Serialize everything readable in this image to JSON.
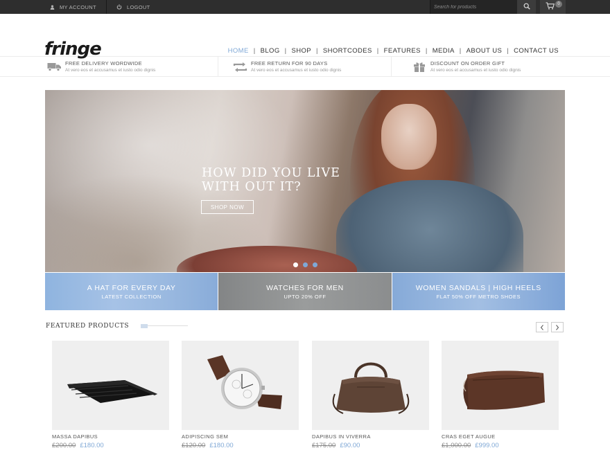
{
  "topbar": {
    "my_account": "MY ACCOUNT",
    "logout": "LOGOUT",
    "search_placeholder": "Search for products",
    "cart_count": "0"
  },
  "header": {
    "logo": "fringe",
    "nav": [
      "HOME",
      "BLOG",
      "SHOP",
      "SHORTCODES",
      "FEATURES",
      "MEDIA",
      "ABOUT US",
      "CONTACT US"
    ],
    "nav_separator": "|",
    "active_nav": "HOME"
  },
  "features": [
    {
      "icon": "truck-icon",
      "title": "FREE DELIVERY WORDWIDE",
      "subtitle": "At vero eos et accusamus et iusto odio dignis"
    },
    {
      "icon": "return-arrows-icon",
      "title": "FREE RETURN FOR 90 DAYS",
      "subtitle": "At vero eos et accusamus et iusto odio dignis"
    },
    {
      "icon": "gift-icon",
      "title": "DISCOUNT ON ORDER GIFT",
      "subtitle": "At vero eos et accusamus et iusto odio dignis"
    }
  ],
  "hero": {
    "title_line1": "HOW DID YOU LIVE",
    "title_line2": "WITH OUT IT?",
    "button": "SHOP NOW",
    "slides": 3,
    "active_slide": 1
  },
  "banners": [
    {
      "title": "A HAT FOR EVERY DAY",
      "subtitle": "LATEST COLLECTION"
    },
    {
      "title": "WATCHES FOR MEN",
      "subtitle": "UPTO 20% OFF"
    },
    {
      "title": "WOMEN SANDALS | HIGH HEELS",
      "subtitle": "FLAT 50% OFF METRO SHOES"
    }
  ],
  "featured": {
    "title": "FEATURED PRODUCTS",
    "products": [
      {
        "name": "MASSA DAPIBUS",
        "old_price": "£200.00",
        "price": "£180.00",
        "image": "wallet"
      },
      {
        "name": "ADIPISCING SEM",
        "old_price": "£120.00",
        "price": "£180.00",
        "image": "watch"
      },
      {
        "name": "DAPIBUS IN VIVERRA",
        "old_price": "£175.00",
        "price": "£90.00",
        "image": "bag"
      },
      {
        "name": "CRAS EGET AUGUE",
        "old_price": "£1,000.00",
        "price": "£999.00",
        "image": "toiletry-bag"
      }
    ]
  },
  "colors": {
    "accent": "#7fa8d6",
    "topbar": "#2e2e2e"
  }
}
